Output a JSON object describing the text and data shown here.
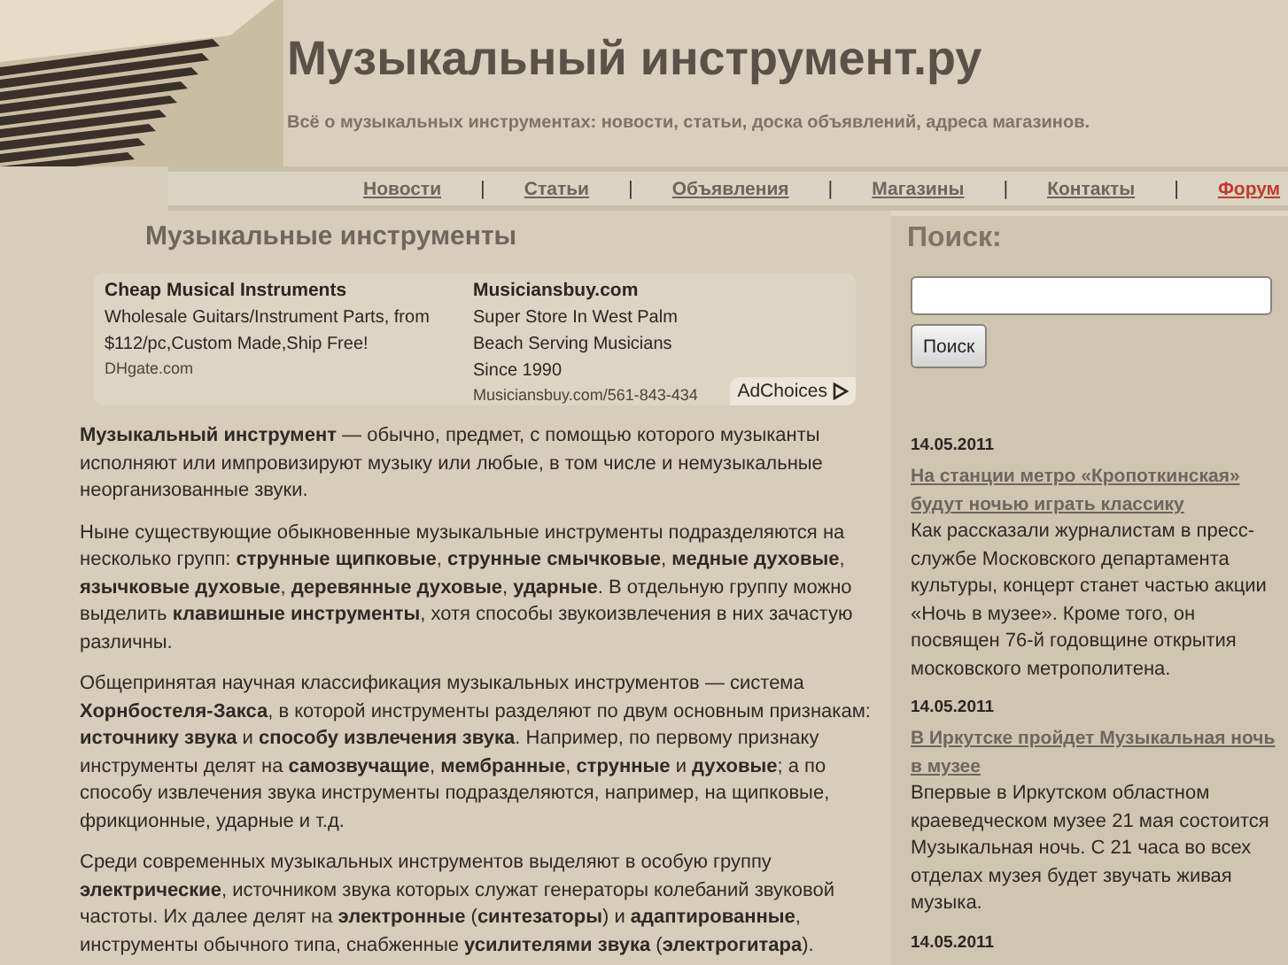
{
  "site": {
    "title": "Музыкальный инструмент.ру",
    "tagline": "Всё о музыкальных инструментах: новости, статьи, доска объявлений, адреса магазинов."
  },
  "nav": [
    {
      "label": "Новости",
      "selected": false,
      "separator": "|"
    },
    {
      "label": "Статьи",
      "selected": false,
      "separator": "|"
    },
    {
      "label": "Объявления",
      "selected": false,
      "separator": "|"
    },
    {
      "label": "Магазины",
      "selected": false,
      "separator": "|"
    },
    {
      "label": "Контакты",
      "selected": false,
      "separator": "|"
    },
    {
      "label": "Форум",
      "selected": true
    }
  ],
  "article": {
    "heading": "Музыкальные инструменты",
    "ads": [
      {
        "title": "Cheap Musical Instruments",
        "text": "Wholesale Guitars/Instrument Parts, from $112/pc,Custom Made,Ship Free!",
        "url": "DHgate.com"
      },
      {
        "title": "Musiciansbuy.com",
        "text": "Super Store In West Palm Beach Serving Musicians Since 1990",
        "url": "Musiciansbuy.com/561-843-434"
      }
    ],
    "adchoices": "AdChoices",
    "paragraphs": [
      "**Музыкальный инструмент** — обычно, предмет, с помощью которого музыканты исполняют или импровизируют музыку или любые, в том числе и немузыкальные неорганизованные звуки.",
      "Ныне существующие обыкновенные музыкальные инструменты подразделяются на несколько групп: **струнные щипковые**, **струнные смычковые**, **медные духовые**, **язычковые духовые**, **деревянные духовые**, **ударные**. В отдельную группу можно выделить **клавишные инструменты**, хотя способы звукоизвлечения в них зачастую различны.",
      "Общепринятая научная классификация музыкальных инструментов — система **Хорнбостеля-Закса**, в которой инструменты разделяют по двум основным признакам: **источнику звука** и **способу извлечения звука**. Например, по первому признаку инструменты делят на **самозвучащие**, **мембранные**, **струнные** и **духовые**; а по способу извлечения звука инструменты подразделяются, например, на щипковые, фрикционные, ударные и т.д.",
      "Среди современных музыкальных инструментов выделяют в особую группу **электрические**, источником звука которых служат генераторы колебаний звуковой частоты. Их далее делят на **электронные** (**синтезаторы**) и **адаптированные**, инструменты обычного типа, снабженные **усилителями звука** (**электрогитара**)."
    ]
  },
  "search": {
    "heading": "Поиск:",
    "button": "Поиск"
  },
  "news": [
    {
      "date": "14.05.2011",
      "title": "На станции метро «Кропоткинская» будут ночью играть классику",
      "text": "Как рассказали журналистам в пресс-службе Московского департамента культуры, концерт станет частью акции «Ночь в музее». Кроме того, он посвящен 76-й годовщине открытия московского метрополитена."
    },
    {
      "date": "14.05.2011",
      "title": "В Иркутске пройдет Музыкальная ночь в музее",
      "text": "Впервые в Иркутском областном краеведческом музее 21 мая состоится Музыкальная ночь. С 21 часа во всех отделах музея будет звучать живая музыка."
    },
    {
      "date": "14.05.2011"
    }
  ]
}
